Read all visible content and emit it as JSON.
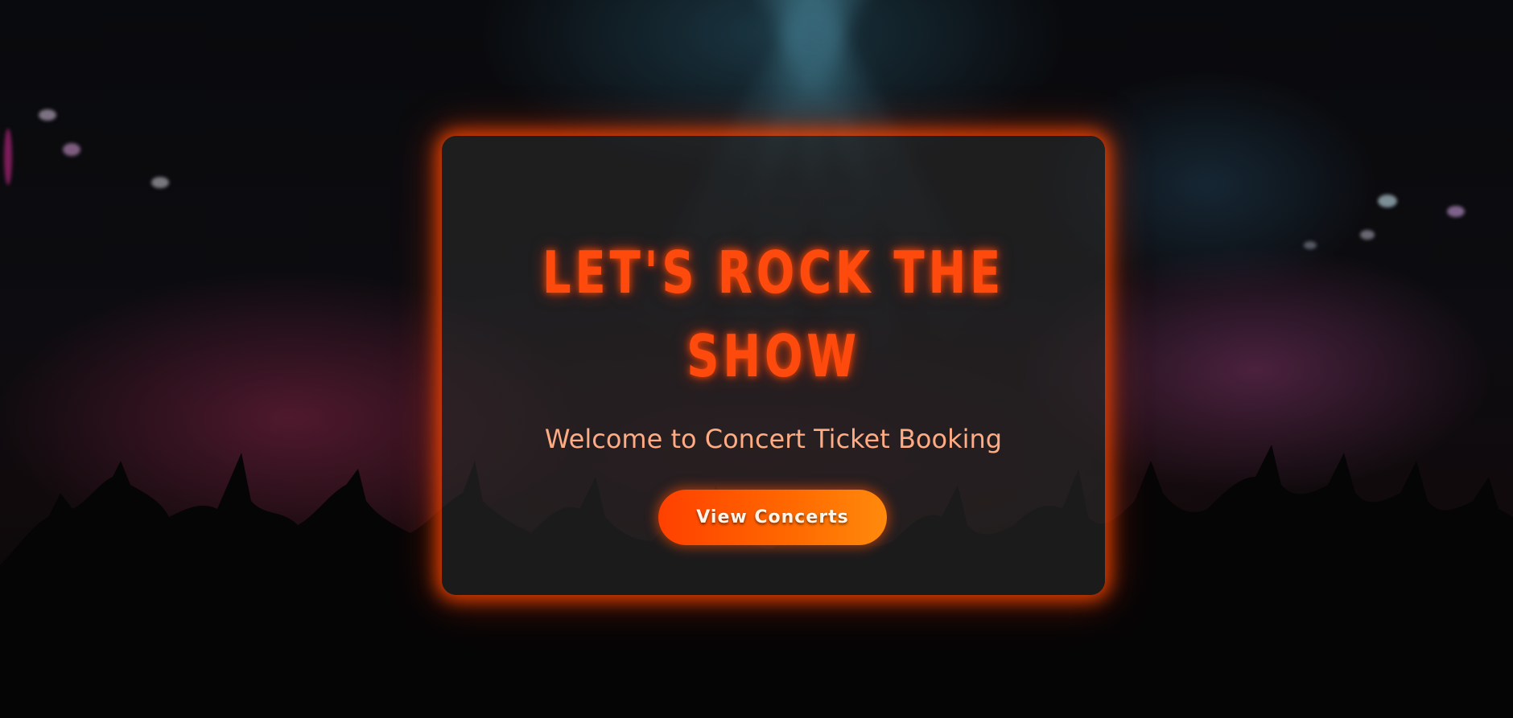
{
  "hero": {
    "title_line1": "LET'S ROCK THE",
    "title_line2": "SHOW",
    "subtitle": "Welcome to Concert Ticket Booking",
    "cta_label": "View Concerts"
  },
  "colors": {
    "accent": "#ff4a0e",
    "subtitle": "#ffab84",
    "button_start": "#ff4000",
    "button_end": "#ff8a0d",
    "card_background": "#2a2a2a"
  },
  "background": {
    "image": "concert-crowd-stage-lights"
  }
}
